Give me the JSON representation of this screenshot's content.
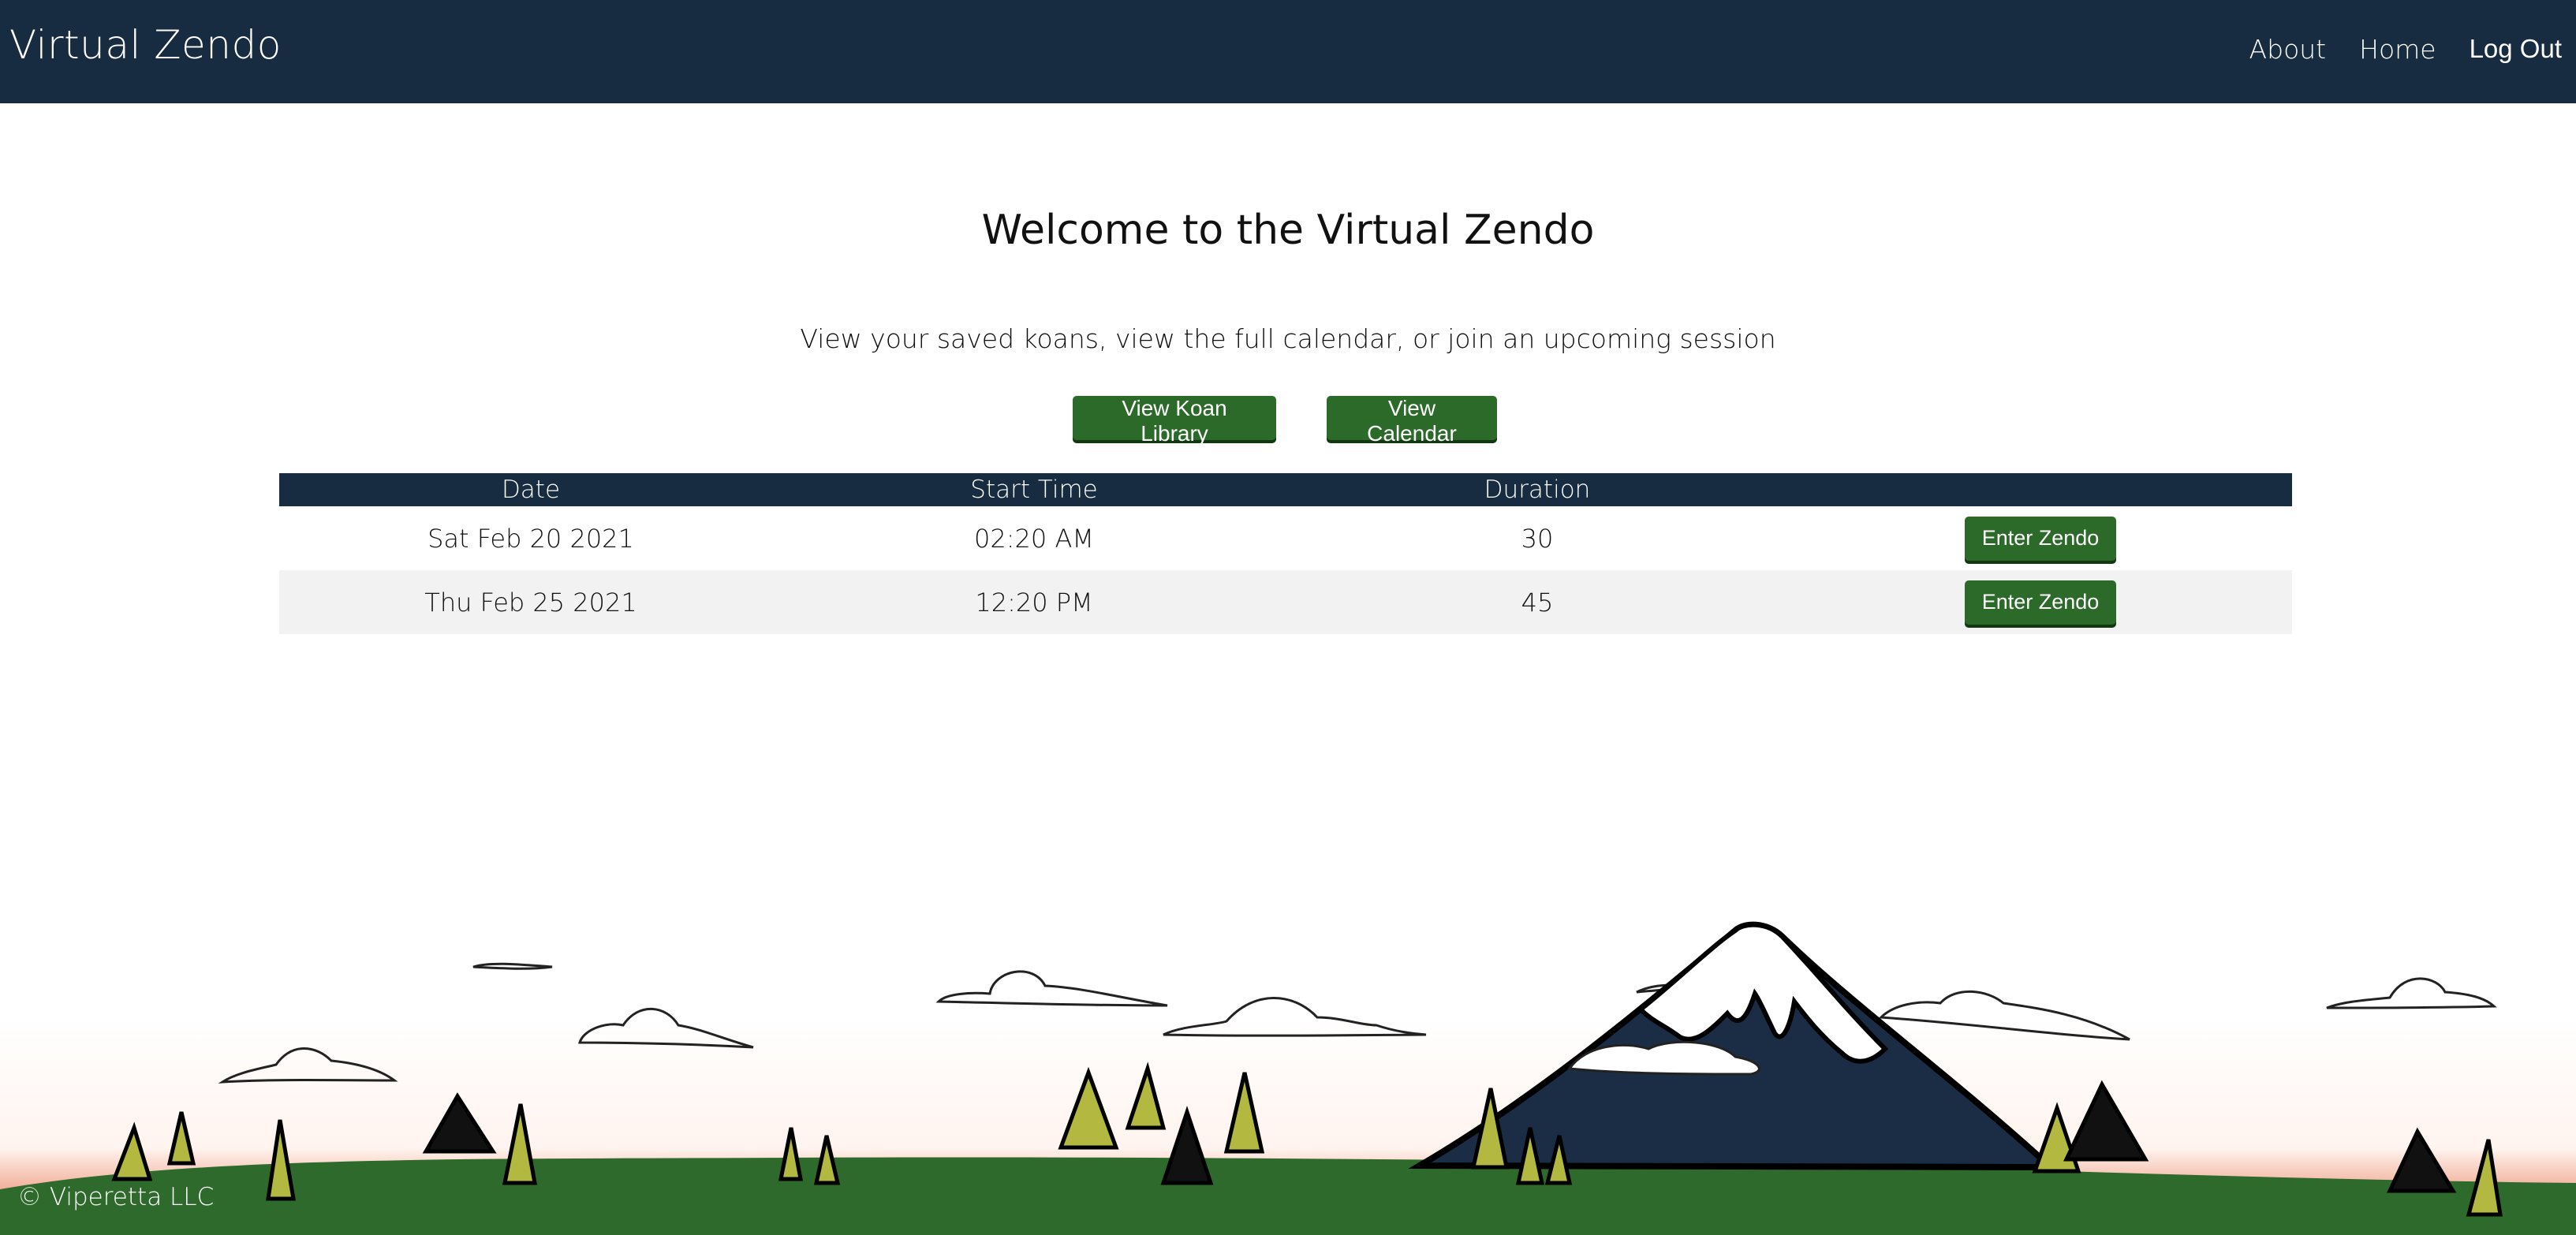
{
  "nav": {
    "brand": "Virtual Zendo",
    "links": [
      {
        "label": "About"
      },
      {
        "label": "Home"
      },
      {
        "label": "Log Out"
      }
    ]
  },
  "main": {
    "title": "Welcome to the Virtual Zendo",
    "subtitle": "View your saved koans, view the full calendar, or join an upcoming session",
    "buttons": {
      "koan_library": "View Koan Library",
      "calendar": "View Calendar"
    }
  },
  "sessions": {
    "headers": [
      "Date",
      "Start Time",
      "Duration",
      ""
    ],
    "rows": [
      {
        "date": "Sat Feb 20 2021",
        "start": "02:20 AM",
        "duration": "30",
        "action": "Enter Zendo"
      },
      {
        "date": "Thu Feb 25 2021",
        "start": "12:20 PM",
        "duration": "45",
        "action": "Enter Zendo"
      }
    ]
  },
  "footer": {
    "copyright": "© Viperetta LLC"
  },
  "colors": {
    "navbar": "#172b41",
    "button": "#2c6a2a",
    "grass": "#2e6a2c",
    "sky_glow": "#e07a5a",
    "mountain": "#1b2c45",
    "tree_fill": "#b3b840"
  },
  "icons": [
    "mountain-landscape-illustration",
    "cloud-icon",
    "pine-tree-icon"
  ]
}
